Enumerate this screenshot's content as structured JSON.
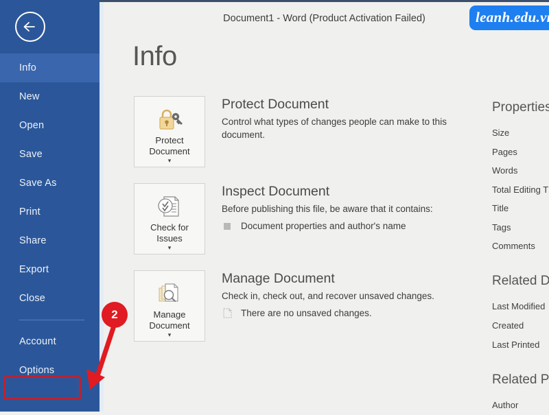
{
  "window": {
    "title": "Document1 - Word (Product Activation Failed)",
    "watermark": "leanh.edu.vn",
    "accent_color": "#2b579a",
    "highlight_color": "#3a66ad",
    "annotation_color": "#e01b22"
  },
  "sidebar": {
    "back_icon": "back-arrow-icon",
    "items": [
      {
        "label": "Info",
        "name": "info",
        "selected": true
      },
      {
        "label": "New",
        "name": "new",
        "selected": false
      },
      {
        "label": "Open",
        "name": "open",
        "selected": false
      },
      {
        "label": "Save",
        "name": "save",
        "selected": false
      },
      {
        "label": "Save As",
        "name": "save-as",
        "selected": false
      },
      {
        "label": "Print",
        "name": "print",
        "selected": false
      },
      {
        "label": "Share",
        "name": "share",
        "selected": false
      },
      {
        "label": "Export",
        "name": "export",
        "selected": false
      },
      {
        "label": "Close",
        "name": "close",
        "selected": false
      }
    ],
    "bottom_items": [
      {
        "label": "Account",
        "name": "account",
        "highlighted": false
      },
      {
        "label": "Options",
        "name": "options",
        "highlighted": true
      }
    ]
  },
  "main": {
    "page_title": "Info",
    "cards": [
      {
        "button_label": "Protect\nDocument",
        "button_icon": "padlock-key-icon",
        "title": "Protect Document",
        "description": "Control what types of changes people can make to this document.",
        "note": null,
        "note_icon": null
      },
      {
        "button_label": "Check for\nIssues",
        "button_icon": "document-inspect-icon",
        "title": "Inspect Document",
        "description": "Before publishing this file, be aware that it contains:",
        "note": "Document properties and author's name",
        "note_icon": "square-bullet-icon"
      },
      {
        "button_label": "Manage\nDocument",
        "button_icon": "document-stack-magnifier-icon",
        "title": "Manage Document",
        "description": "Check in, check out, and recover unsaved changes.",
        "note": "There are no unsaved changes.",
        "note_icon": "dashed-document-icon"
      }
    ]
  },
  "properties_pane": {
    "heading": "Properties",
    "rows": [
      "Size",
      "Pages",
      "Words",
      "Total Editing T",
      "Title",
      "Tags",
      "Comments"
    ],
    "related_dates_heading": "Related Da",
    "related_dates_rows": [
      "Last Modified",
      "Created",
      "Last Printed"
    ],
    "related_people_heading": "Related Pe",
    "related_people_rows": [
      "Author"
    ]
  },
  "annotation": {
    "step_number": "2",
    "target": "options"
  }
}
